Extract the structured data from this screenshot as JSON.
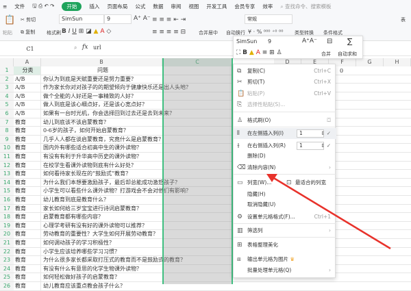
{
  "menubar": {
    "file": "文件",
    "tabs": [
      "开始",
      "插入",
      "页面布局",
      "公式",
      "数据",
      "审阅",
      "视图",
      "开发工具",
      "会员专享",
      "效率"
    ],
    "search_placeholder": "查找命令、搜索模板"
  },
  "ribbon": {
    "paste": "粘贴",
    "cut": "剪切",
    "copy": "复制",
    "format_painter": "格式刷",
    "font": "SimSun",
    "size": "9",
    "merge_center": "合并居中",
    "wrap": "自动换行",
    "number_format": "常规",
    "convert": "类型转换",
    "cond_format": "条件格式",
    "table": "表"
  },
  "formula_bar": {
    "cell_ref": "C1",
    "fx": "fx",
    "value": "url"
  },
  "columns": [
    "A",
    "B",
    "C",
    "D",
    "E",
    "F",
    "G",
    "H"
  ],
  "f1_value": "0",
  "rows": [
    [
      "分类",
      "问题"
    ],
    [
      "A/B",
      "你认为到底是天赋重要还是努力重要？"
    ],
    [
      "A/B",
      "作为家长你对对孩子的的期望倾向于健康快乐还是出人头地？"
    ],
    [
      "A/B",
      "做个全能的人好还是一事精致的人好？"
    ],
    [
      "A/B",
      "做人到底是该心细点好，还是该心宽点好？"
    ],
    [
      "A/B",
      "如果有一台时光机，你会选择回到过去还是去到未来？"
    ],
    [
      "教育",
      "幼儿到底该不该启蒙教育？"
    ],
    [
      "教育",
      "0-6岁的孩子，如何开始启蒙教育？"
    ],
    [
      "教育",
      "几乎人人都在谈启蒙教育，究竟什么是启蒙教育？"
    ],
    [
      "教育",
      "国内外有哪些适合初高中生的课外读物？"
    ],
    [
      "教育",
      "有没有有利于升华高中历史的课外读物？"
    ],
    [
      "教育",
      "在校学生看课外读物到底有什么好处？"
    ],
    [
      "教育",
      "如何看待家长现在的“鼓励式”教育？"
    ],
    [
      "教育",
      "为什么我们本想要激励孩子，最后却总能成功激怒孩子？"
    ],
    [
      "教育",
      "小学生可以看些什么课外读物？打游戏会不会对他们有影响？"
    ],
    [
      "教育",
      "幼儿教育到底是教育什么？"
    ],
    [
      "教育",
      "家长如何给三岁宝宝进行诗词启蒙教育？"
    ],
    [
      "教育",
      "启蒙教育都有哪些内容？"
    ],
    [
      "教育",
      "心理学考研有没有好的课外读物可以推荐？"
    ],
    [
      "教育",
      "劳动教育的重要性？大学生如何开展劳动教育？"
    ],
    [
      "教育",
      "如何调动孩子的学习积极性？"
    ],
    [
      "教育",
      "小学生应该培养哪些学习习惯？"
    ],
    [
      "教育",
      "为什么很多家长都采取打压式的教育而不是鼓励式的教育？"
    ],
    [
      "教育",
      "有没有什么有意思的化学生物课外读物？"
    ],
    [
      "教育",
      "如何轻松做好孩子的启蒙教育？"
    ],
    [
      "教育",
      "幼儿教育应该重点教会孩子什么？"
    ]
  ],
  "mini_toolbar": {
    "font": "SimSun",
    "size": "9",
    "merge": "合并",
    "autosum": "自动求和"
  },
  "context_menu": {
    "copy": "复制(C)",
    "copy_sc": "Ctrl+C",
    "cut": "剪切(T)",
    "cut_sc": "Ctrl+X",
    "paste": "粘贴(P)",
    "paste_sc": "Ctrl+V",
    "paste_special": "选择性粘贴(S)...",
    "format_painter": "格式刷(O)",
    "insert_left": "在左侧插入列(I)",
    "insert_left_val": "1",
    "insert_right": "在右侧插入列(R)",
    "insert_right_val": "1",
    "delete": "删除(D)",
    "clear": "清除内容(N)",
    "col_width": "列宽(W)...",
    "best_fit": "最适合的列宽",
    "hide": "隐藏(H)",
    "unhide": "取消隐藏(U)",
    "format_cells": "设置单元格格式(F)...",
    "format_cells_sc": "Ctrl+1",
    "filter": "筛选列",
    "beautify": "表格整理美化",
    "export_img": "输出单元格为图片",
    "batch": "批量处理单元格(Q)"
  },
  "colors": {
    "accent": "#1fa35c",
    "arrow": "#e8322b"
  }
}
